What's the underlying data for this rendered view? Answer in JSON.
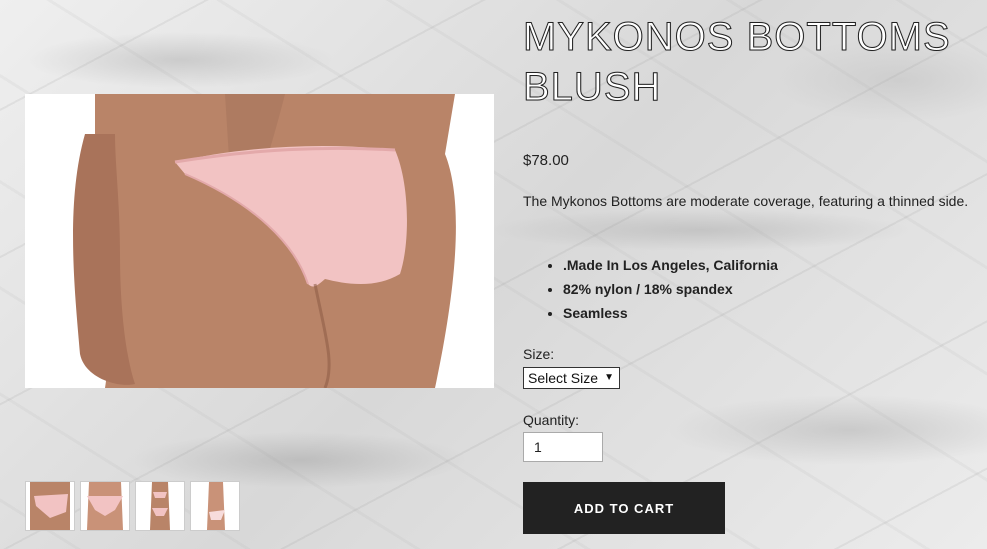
{
  "product": {
    "title": "MYKONOS BOTTOMS BLUSH",
    "price": "$78.00",
    "description": "The Mykonos Bottoms are moderate coverage, featuring a thinned side.",
    "features": [
      ".Made In Los Angeles, California",
      "82% nylon / 18% spandex",
      "Seamless"
    ]
  },
  "size": {
    "label": "Size:",
    "selected": "Select Size"
  },
  "quantity": {
    "label": "Quantity:",
    "value": "1"
  },
  "cart": {
    "button_label": "ADD TO CART"
  },
  "gallery": {
    "thumbnail_count": 4,
    "selected_index": 0
  },
  "colors": {
    "swim_pink": "#f2c3c3",
    "skin": "#b98468",
    "button_bg": "#222222"
  },
  "icons": {
    "select_caret": "dropdown-caret-icon"
  }
}
